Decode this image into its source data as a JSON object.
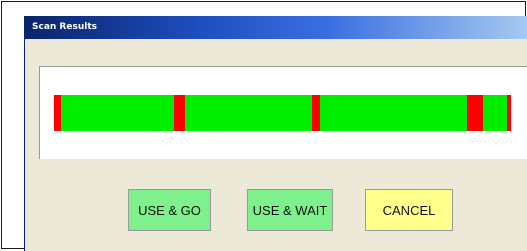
{
  "window": {
    "title": "Scan Results"
  },
  "scan_bar": {
    "segments": [
      {
        "status": "fail",
        "fraction": 0.015
      },
      {
        "status": "pass",
        "fraction": 0.248
      },
      {
        "status": "fail",
        "fraction": 0.024
      },
      {
        "status": "pass",
        "fraction": 0.278
      },
      {
        "status": "fail",
        "fraction": 0.017
      },
      {
        "status": "pass",
        "fraction": 0.321
      },
      {
        "status": "fail",
        "fraction": 0.035
      },
      {
        "status": "pass",
        "fraction": 0.053
      },
      {
        "status": "fail",
        "fraction": 0.009
      }
    ]
  },
  "buttons": {
    "use_go": "USE & GO",
    "use_wait": "USE & WAIT",
    "cancel": "CANCEL"
  },
  "colors": {
    "pass": "#00ee00",
    "fail": "#ff0000",
    "use_go_bg": "#7ef08c",
    "use_wait_bg": "#7ef08c",
    "cancel_bg": "#ffff8c",
    "dialog_bg": "#ece9d8",
    "title_bar": "#0a246a"
  }
}
